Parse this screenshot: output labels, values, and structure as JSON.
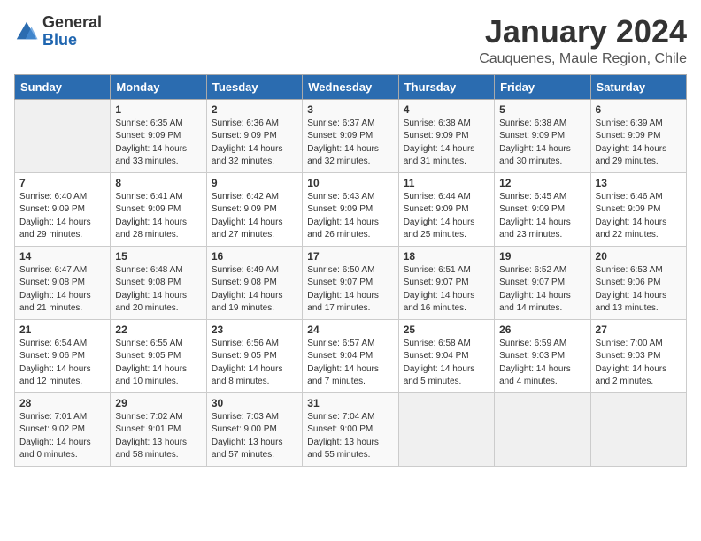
{
  "logo": {
    "text_general": "General",
    "text_blue": "Blue"
  },
  "calendar": {
    "title": "January 2024",
    "subtitle": "Cauquenes, Maule Region, Chile"
  },
  "headers": [
    "Sunday",
    "Monday",
    "Tuesday",
    "Wednesday",
    "Thursday",
    "Friday",
    "Saturday"
  ],
  "weeks": [
    [
      {
        "day": "",
        "sunrise": "",
        "sunset": "",
        "daylight": ""
      },
      {
        "day": "1",
        "sunrise": "Sunrise: 6:35 AM",
        "sunset": "Sunset: 9:09 PM",
        "daylight": "Daylight: 14 hours and 33 minutes."
      },
      {
        "day": "2",
        "sunrise": "Sunrise: 6:36 AM",
        "sunset": "Sunset: 9:09 PM",
        "daylight": "Daylight: 14 hours and 32 minutes."
      },
      {
        "day": "3",
        "sunrise": "Sunrise: 6:37 AM",
        "sunset": "Sunset: 9:09 PM",
        "daylight": "Daylight: 14 hours and 32 minutes."
      },
      {
        "day": "4",
        "sunrise": "Sunrise: 6:38 AM",
        "sunset": "Sunset: 9:09 PM",
        "daylight": "Daylight: 14 hours and 31 minutes."
      },
      {
        "day": "5",
        "sunrise": "Sunrise: 6:38 AM",
        "sunset": "Sunset: 9:09 PM",
        "daylight": "Daylight: 14 hours and 30 minutes."
      },
      {
        "day": "6",
        "sunrise": "Sunrise: 6:39 AM",
        "sunset": "Sunset: 9:09 PM",
        "daylight": "Daylight: 14 hours and 29 minutes."
      }
    ],
    [
      {
        "day": "7",
        "sunrise": "Sunrise: 6:40 AM",
        "sunset": "Sunset: 9:09 PM",
        "daylight": "Daylight: 14 hours and 29 minutes."
      },
      {
        "day": "8",
        "sunrise": "Sunrise: 6:41 AM",
        "sunset": "Sunset: 9:09 PM",
        "daylight": "Daylight: 14 hours and 28 minutes."
      },
      {
        "day": "9",
        "sunrise": "Sunrise: 6:42 AM",
        "sunset": "Sunset: 9:09 PM",
        "daylight": "Daylight: 14 hours and 27 minutes."
      },
      {
        "day": "10",
        "sunrise": "Sunrise: 6:43 AM",
        "sunset": "Sunset: 9:09 PM",
        "daylight": "Daylight: 14 hours and 26 minutes."
      },
      {
        "day": "11",
        "sunrise": "Sunrise: 6:44 AM",
        "sunset": "Sunset: 9:09 PM",
        "daylight": "Daylight: 14 hours and 25 minutes."
      },
      {
        "day": "12",
        "sunrise": "Sunrise: 6:45 AM",
        "sunset": "Sunset: 9:09 PM",
        "daylight": "Daylight: 14 hours and 23 minutes."
      },
      {
        "day": "13",
        "sunrise": "Sunrise: 6:46 AM",
        "sunset": "Sunset: 9:09 PM",
        "daylight": "Daylight: 14 hours and 22 minutes."
      }
    ],
    [
      {
        "day": "14",
        "sunrise": "Sunrise: 6:47 AM",
        "sunset": "Sunset: 9:08 PM",
        "daylight": "Daylight: 14 hours and 21 minutes."
      },
      {
        "day": "15",
        "sunrise": "Sunrise: 6:48 AM",
        "sunset": "Sunset: 9:08 PM",
        "daylight": "Daylight: 14 hours and 20 minutes."
      },
      {
        "day": "16",
        "sunrise": "Sunrise: 6:49 AM",
        "sunset": "Sunset: 9:08 PM",
        "daylight": "Daylight: 14 hours and 19 minutes."
      },
      {
        "day": "17",
        "sunrise": "Sunrise: 6:50 AM",
        "sunset": "Sunset: 9:07 PM",
        "daylight": "Daylight: 14 hours and 17 minutes."
      },
      {
        "day": "18",
        "sunrise": "Sunrise: 6:51 AM",
        "sunset": "Sunset: 9:07 PM",
        "daylight": "Daylight: 14 hours and 16 minutes."
      },
      {
        "day": "19",
        "sunrise": "Sunrise: 6:52 AM",
        "sunset": "Sunset: 9:07 PM",
        "daylight": "Daylight: 14 hours and 14 minutes."
      },
      {
        "day": "20",
        "sunrise": "Sunrise: 6:53 AM",
        "sunset": "Sunset: 9:06 PM",
        "daylight": "Daylight: 14 hours and 13 minutes."
      }
    ],
    [
      {
        "day": "21",
        "sunrise": "Sunrise: 6:54 AM",
        "sunset": "Sunset: 9:06 PM",
        "daylight": "Daylight: 14 hours and 12 minutes."
      },
      {
        "day": "22",
        "sunrise": "Sunrise: 6:55 AM",
        "sunset": "Sunset: 9:05 PM",
        "daylight": "Daylight: 14 hours and 10 minutes."
      },
      {
        "day": "23",
        "sunrise": "Sunrise: 6:56 AM",
        "sunset": "Sunset: 9:05 PM",
        "daylight": "Daylight: 14 hours and 8 minutes."
      },
      {
        "day": "24",
        "sunrise": "Sunrise: 6:57 AM",
        "sunset": "Sunset: 9:04 PM",
        "daylight": "Daylight: 14 hours and 7 minutes."
      },
      {
        "day": "25",
        "sunrise": "Sunrise: 6:58 AM",
        "sunset": "Sunset: 9:04 PM",
        "daylight": "Daylight: 14 hours and 5 minutes."
      },
      {
        "day": "26",
        "sunrise": "Sunrise: 6:59 AM",
        "sunset": "Sunset: 9:03 PM",
        "daylight": "Daylight: 14 hours and 4 minutes."
      },
      {
        "day": "27",
        "sunrise": "Sunrise: 7:00 AM",
        "sunset": "Sunset: 9:03 PM",
        "daylight": "Daylight: 14 hours and 2 minutes."
      }
    ],
    [
      {
        "day": "28",
        "sunrise": "Sunrise: 7:01 AM",
        "sunset": "Sunset: 9:02 PM",
        "daylight": "Daylight: 14 hours and 0 minutes."
      },
      {
        "day": "29",
        "sunrise": "Sunrise: 7:02 AM",
        "sunset": "Sunset: 9:01 PM",
        "daylight": "Daylight: 13 hours and 58 minutes."
      },
      {
        "day": "30",
        "sunrise": "Sunrise: 7:03 AM",
        "sunset": "Sunset: 9:00 PM",
        "daylight": "Daylight: 13 hours and 57 minutes."
      },
      {
        "day": "31",
        "sunrise": "Sunrise: 7:04 AM",
        "sunset": "Sunset: 9:00 PM",
        "daylight": "Daylight: 13 hours and 55 minutes."
      },
      {
        "day": "",
        "sunrise": "",
        "sunset": "",
        "daylight": ""
      },
      {
        "day": "",
        "sunrise": "",
        "sunset": "",
        "daylight": ""
      },
      {
        "day": "",
        "sunrise": "",
        "sunset": "",
        "daylight": ""
      }
    ]
  ]
}
